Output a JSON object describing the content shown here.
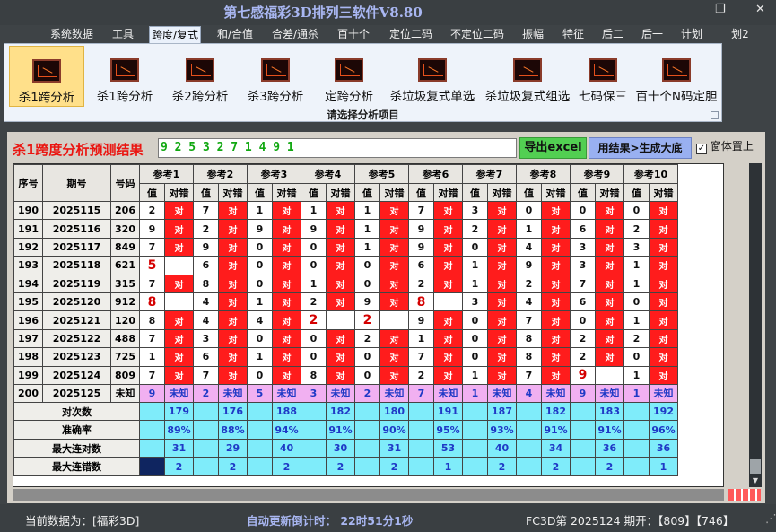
{
  "window": {
    "title": "第七感福彩3D排列三软件V8.80",
    "restore_glyph": "❐",
    "close_glyph": "✕"
  },
  "menu": [
    "系统数据",
    "工具",
    "跨度/复式",
    "和/合值",
    "合差/通杀",
    "百十个",
    "定位二码",
    "不定位二码",
    "振幅",
    "特征",
    "后二",
    "后一",
    "计划",
    "划2"
  ],
  "menu_active": "跨度/复式",
  "ribbon": {
    "buttons": [
      "杀1跨分析",
      "杀1跨分析",
      "杀2跨分析",
      "杀3跨分析",
      "定跨分析",
      "杀垃圾复式单选",
      "杀垃圾复式组选",
      "七码保三",
      "百十个N码定胆"
    ],
    "selected": 0,
    "caption": "请选择分析项目"
  },
  "analysis": {
    "title": "杀1跨度分析预测结果",
    "result_value": "9 2 5 3 2 7 1 4 9 1",
    "excel_button": "导出excel",
    "generate_button": "用结果>生成大底",
    "topmost_label": "窗体置上",
    "topmost_checked": true
  },
  "table": {
    "col_seq": "序号",
    "col_period": "期号",
    "col_number": "号码",
    "ref_headers": [
      "参考1",
      "参考2",
      "参考3",
      "参考4",
      "参考5",
      "参考6",
      "参考7",
      "参考8",
      "参考9",
      "参考10"
    ],
    "sub_value": "值",
    "sub_check": "对错",
    "check_text": "对",
    "rows": [
      {
        "seq": "190",
        "period": "2025115",
        "number": "206",
        "vals": [
          "2",
          "7",
          "1",
          "1",
          "1",
          "7",
          "3",
          "0",
          "0",
          "0"
        ],
        "hits": [
          1,
          1,
          1,
          1,
          1,
          1,
          1,
          1,
          1,
          1
        ]
      },
      {
        "seq": "191",
        "period": "2025116",
        "number": "320",
        "vals": [
          "9",
          "2",
          "9",
          "9",
          "1",
          "9",
          "2",
          "1",
          "6",
          "2"
        ],
        "hits": [
          1,
          1,
          1,
          1,
          1,
          1,
          1,
          1,
          1,
          1
        ]
      },
      {
        "seq": "192",
        "period": "2025117",
        "number": "849",
        "vals": [
          "7",
          "9",
          "0",
          "0",
          "1",
          "9",
          "0",
          "4",
          "3",
          "3"
        ],
        "hits": [
          1,
          1,
          1,
          1,
          1,
          1,
          1,
          1,
          1,
          1
        ]
      },
      {
        "seq": "193",
        "period": "2025118",
        "number": "621",
        "vals": [
          "5",
          "6",
          "0",
          "0",
          "0",
          "6",
          "1",
          "9",
          "3",
          "1"
        ],
        "hits": [
          0,
          1,
          1,
          1,
          1,
          1,
          1,
          1,
          1,
          1
        ]
      },
      {
        "seq": "194",
        "period": "2025119",
        "number": "315",
        "vals": [
          "7",
          "8",
          "0",
          "1",
          "0",
          "2",
          "1",
          "2",
          "7",
          "1"
        ],
        "hits": [
          1,
          1,
          1,
          1,
          1,
          1,
          1,
          1,
          1,
          1
        ]
      },
      {
        "seq": "195",
        "period": "2025120",
        "number": "912",
        "vals": [
          "8",
          "4",
          "1",
          "2",
          "9",
          "8",
          "3",
          "4",
          "6",
          "0"
        ],
        "hits": [
          0,
          1,
          1,
          1,
          1,
          0,
          1,
          1,
          1,
          1
        ]
      },
      {
        "seq": "196",
        "period": "2025121",
        "number": "120",
        "vals": [
          "8",
          "4",
          "4",
          "2",
          "2",
          "9",
          "0",
          "7",
          "0",
          "1"
        ],
        "hits": [
          1,
          1,
          1,
          0,
          0,
          1,
          1,
          1,
          1,
          1
        ]
      },
      {
        "seq": "197",
        "period": "2025122",
        "number": "488",
        "vals": [
          "7",
          "3",
          "0",
          "0",
          "2",
          "1",
          "0",
          "8",
          "2",
          "2"
        ],
        "hits": [
          1,
          1,
          1,
          1,
          1,
          1,
          1,
          1,
          1,
          1
        ]
      },
      {
        "seq": "198",
        "period": "2025123",
        "number": "725",
        "vals": [
          "1",
          "6",
          "1",
          "0",
          "0",
          "7",
          "0",
          "8",
          "2",
          "0"
        ],
        "hits": [
          1,
          1,
          1,
          1,
          1,
          1,
          1,
          1,
          1,
          1
        ]
      },
      {
        "seq": "199",
        "period": "2025124",
        "number": "809",
        "vals": [
          "7",
          "7",
          "0",
          "8",
          "0",
          "2",
          "1",
          "7",
          "9",
          "1"
        ],
        "hits": [
          1,
          1,
          1,
          1,
          1,
          1,
          1,
          1,
          0,
          1
        ]
      }
    ],
    "predict_row": {
      "seq": "200",
      "period": "2025125",
      "number": "未知",
      "vals": [
        "9",
        "2",
        "5",
        "3",
        "2",
        "7",
        "1",
        "4",
        "9",
        "1"
      ],
      "unknown": "未知"
    },
    "stats": [
      {
        "label": "对次数",
        "vals": [
          "179",
          "176",
          "188",
          "182",
          "180",
          "191",
          "187",
          "182",
          "183",
          "192"
        ]
      },
      {
        "label": "准确率",
        "vals": [
          "89%",
          "88%",
          "94%",
          "91%",
          "90%",
          "95%",
          "93%",
          "91%",
          "91%",
          "96%"
        ]
      },
      {
        "label": "最大连对数",
        "vals": [
          "31",
          "29",
          "40",
          "30",
          "31",
          "53",
          "40",
          "34",
          "36",
          "36"
        ]
      },
      {
        "label": "最大连错数",
        "vals": [
          "2",
          "2",
          "2",
          "2",
          "2",
          "1",
          "2",
          "2",
          "2",
          "1"
        ]
      }
    ]
  },
  "status": {
    "current_data": "当前数据为：[福彩3D]",
    "countdown": "自动更新倒计时： 22时51分1秒",
    "latest": "FC3D第 2025124 期开：【809】【746】"
  },
  "colors": {
    "hit": "#ff1c1c",
    "predict_row": "#f1b0f1",
    "stats": "#7fecfa",
    "accent_blue": "#1f39c6"
  }
}
